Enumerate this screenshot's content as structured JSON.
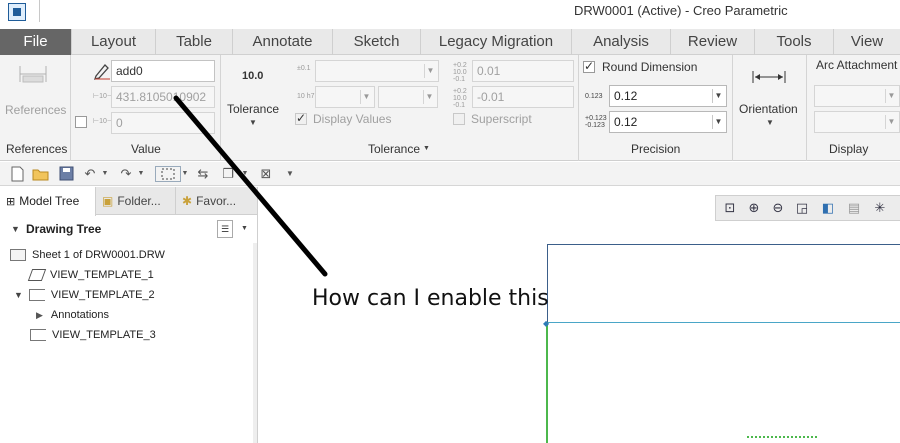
{
  "titlebar": {
    "title": "DRW0001 (Active) - Creo Parametric"
  },
  "ribbon_tabs": [
    "File",
    "Layout",
    "Table",
    "Annotate",
    "Sketch",
    "Legacy Migration",
    "Analysis",
    "Review",
    "Tools",
    "View"
  ],
  "references_group": {
    "button_label": "References",
    "group_label": "References"
  },
  "value_group": {
    "group_label": "Value",
    "name_value": "add0",
    "nominal_value": "431.8105010902",
    "override_value": "0",
    "tiny_nominal": "⊢10⊣",
    "tiny_override": "⊢10⊣"
  },
  "tolerance_group": {
    "group_label": "Tolerance",
    "tolerance_button_label": "Tolerance",
    "tolerance_icon_text": "10.0",
    "display_values_label": "Display Values",
    "superscript_label": "Superscript",
    "upper_value": "0.01",
    "lower_value": "-0.01",
    "tiny_a": "±0.1",
    "tiny_b": "10 h7"
  },
  "precision_group": {
    "group_label": "Precision",
    "round_dimension_label": "Round Dimension",
    "round_dimension_checked": true,
    "precision_value": "0.12",
    "tolerance_precision_value": "0.12"
  },
  "orientation_group": {
    "button_label": "Orientation"
  },
  "display_group": {
    "group_label": "Display",
    "arc_attachment_label": "Arc Attachment"
  },
  "left_panel": {
    "tabs": [
      "Model Tree",
      "Folder...",
      "Favor..."
    ],
    "tree_title": "Drawing Tree",
    "items": [
      {
        "label": "Sheet 1 of DRW0001.DRW"
      },
      {
        "label": "VIEW_TEMPLATE_1"
      },
      {
        "label": "VIEW_TEMPLATE_2"
      },
      {
        "label": "Annotations"
      },
      {
        "label": "VIEW_TEMPLATE_3"
      }
    ]
  },
  "annotation": {
    "text": "How can I enable this"
  },
  "colors": {
    "file_tab": "#666666",
    "ribbon_bg": "#f3f3f3",
    "accent": "#1f5c99",
    "sheet_line": "#4aa6c7",
    "green_line": "#4cb84c"
  }
}
